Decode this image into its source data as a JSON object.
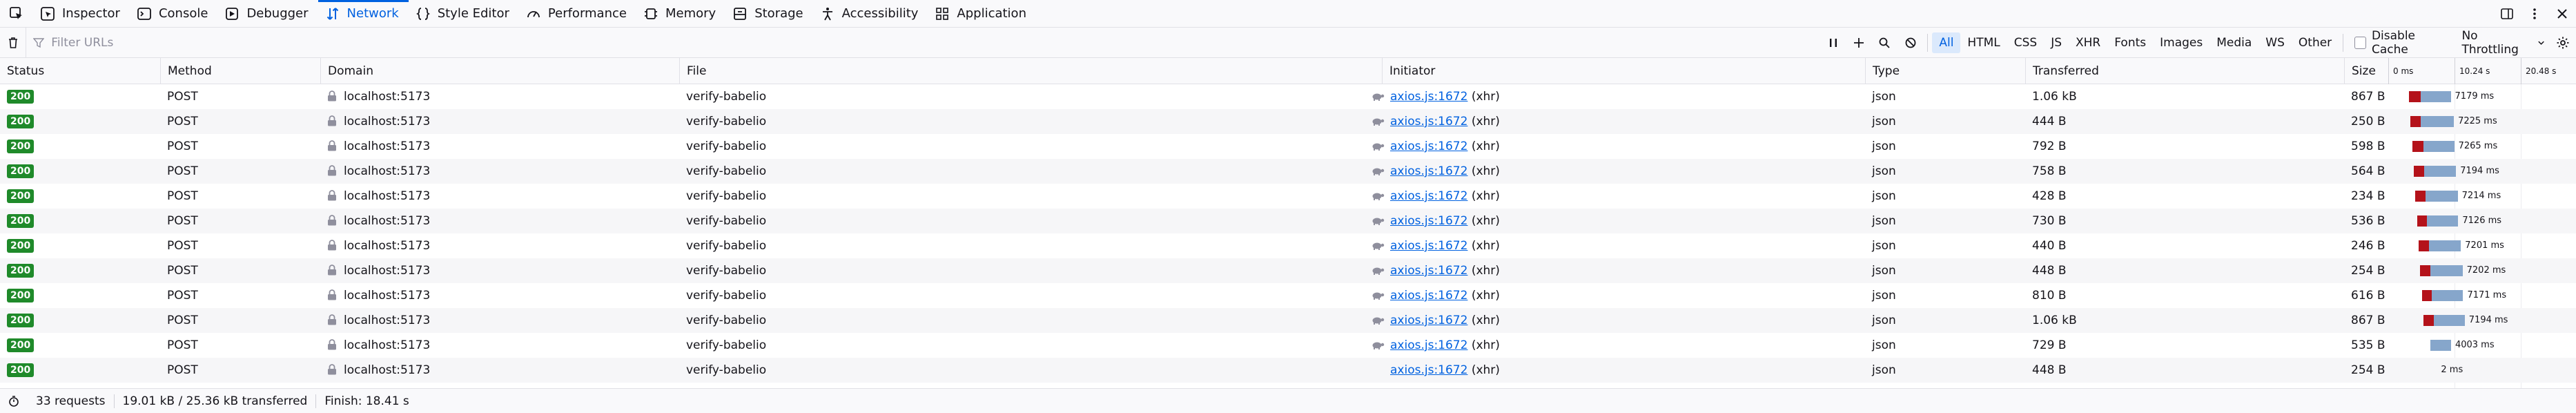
{
  "tabs": [
    {
      "label": "Inspector",
      "icon": "inspector-icon"
    },
    {
      "label": "Console",
      "icon": "console-icon"
    },
    {
      "label": "Debugger",
      "icon": "debugger-icon"
    },
    {
      "label": "Network",
      "icon": "network-icon",
      "selected": true
    },
    {
      "label": "Style Editor",
      "icon": "style-editor-icon"
    },
    {
      "label": "Performance",
      "icon": "performance-icon"
    },
    {
      "label": "Memory",
      "icon": "memory-icon"
    },
    {
      "label": "Storage",
      "icon": "storage-icon"
    },
    {
      "label": "Accessibility",
      "icon": "accessibility-icon"
    },
    {
      "label": "Application",
      "icon": "application-icon"
    }
  ],
  "toolbar": {
    "filter_placeholder": "Filter URLs",
    "types": [
      {
        "label": "All",
        "checked": true
      },
      {
        "label": "HTML"
      },
      {
        "label": "CSS"
      },
      {
        "label": "JS"
      },
      {
        "label": "XHR"
      },
      {
        "label": "Fonts"
      },
      {
        "label": "Images"
      },
      {
        "label": "Media"
      },
      {
        "label": "WS"
      },
      {
        "label": "Other"
      }
    ],
    "disable_cache_label": "Disable Cache",
    "throttling_label": "No Throttling"
  },
  "columns": {
    "status": "Status",
    "method": "Method",
    "domain": "Domain",
    "file": "File",
    "initiator": "Initiator",
    "type": "Type",
    "transferred": "Transferred",
    "size": "Size"
  },
  "waterfall_ticks": [
    "0 ms",
    "10.24 s",
    "20.48 s"
  ],
  "requests": [
    {
      "status": "200",
      "method": "POST",
      "domain": "localhost:5173",
      "file": "verify-babelio",
      "initiator_link": "axios.js:1672",
      "initiator_cause": "(xhr)",
      "throttled": true,
      "type": "json",
      "transferred": "1.06 kB",
      "size": "867 B",
      "start": 0.0,
      "blocked": 0.7,
      "wait": 1.4,
      "timing": "7179 ms"
    },
    {
      "status": "200",
      "method": "POST",
      "domain": "localhost:5173",
      "file": "verify-babelio",
      "initiator_link": "axios.js:1672",
      "initiator_cause": "(xhr)",
      "throttled": true,
      "type": "json",
      "transferred": "444 B",
      "size": "250 B",
      "start": 0.25,
      "blocked": 0.6,
      "wait": 1.55,
      "timing": "7225 ms"
    },
    {
      "status": "200",
      "method": "POST",
      "domain": "localhost:5173",
      "file": "verify-babelio",
      "initiator_link": "axios.js:1672",
      "initiator_cause": "(xhr)",
      "throttled": true,
      "type": "json",
      "transferred": "792 B",
      "size": "598 B",
      "start": 0.5,
      "blocked": 0.65,
      "wait": 1.45,
      "timing": "7265 ms"
    },
    {
      "status": "200",
      "method": "POST",
      "domain": "localhost:5173",
      "file": "verify-babelio",
      "initiator_link": "axios.js:1672",
      "initiator_cause": "(xhr)",
      "throttled": true,
      "type": "json",
      "transferred": "758 B",
      "size": "564 B",
      "start": 0.75,
      "blocked": 0.6,
      "wait": 1.5,
      "timing": "7194 ms"
    },
    {
      "status": "200",
      "method": "POST",
      "domain": "localhost:5173",
      "file": "verify-babelio",
      "initiator_link": "axios.js:1672",
      "initiator_cause": "(xhr)",
      "throttled": true,
      "type": "json",
      "transferred": "428 B",
      "size": "234 B",
      "start": 1.0,
      "blocked": 0.6,
      "wait": 1.5,
      "timing": "7214 ms"
    },
    {
      "status": "200",
      "method": "POST",
      "domain": "localhost:5173",
      "file": "verify-babelio",
      "initiator_link": "axios.js:1672",
      "initiator_cause": "(xhr)",
      "throttled": true,
      "type": "json",
      "transferred": "730 B",
      "size": "536 B",
      "start": 1.25,
      "blocked": 0.6,
      "wait": 1.45,
      "timing": "7126 ms"
    },
    {
      "status": "200",
      "method": "POST",
      "domain": "localhost:5173",
      "file": "verify-babelio",
      "initiator_link": "axios.js:1672",
      "initiator_cause": "(xhr)",
      "throttled": true,
      "type": "json",
      "transferred": "440 B",
      "size": "246 B",
      "start": 1.5,
      "blocked": 0.6,
      "wait": 1.5,
      "timing": "7201 ms"
    },
    {
      "status": "200",
      "method": "POST",
      "domain": "localhost:5173",
      "file": "verify-babelio",
      "initiator_link": "axios.js:1672",
      "initiator_cause": "(xhr)",
      "throttled": true,
      "type": "json",
      "transferred": "448 B",
      "size": "254 B",
      "start": 1.75,
      "blocked": 0.6,
      "wait": 1.5,
      "timing": "7202 ms"
    },
    {
      "status": "200",
      "method": "POST",
      "domain": "localhost:5173",
      "file": "verify-babelio",
      "initiator_link": "axios.js:1672",
      "initiator_cause": "(xhr)",
      "throttled": true,
      "type": "json",
      "transferred": "810 B",
      "size": "616 B",
      "start": 2.0,
      "blocked": 0.6,
      "wait": 1.45,
      "timing": "7171 ms"
    },
    {
      "status": "200",
      "method": "POST",
      "domain": "localhost:5173",
      "file": "verify-babelio",
      "initiator_link": "axios.js:1672",
      "initiator_cause": "(xhr)",
      "throttled": true,
      "type": "json",
      "transferred": "1.06 kB",
      "size": "867 B",
      "start": 2.25,
      "blocked": 0.6,
      "wait": 1.45,
      "timing": "7194 ms"
    },
    {
      "status": "200",
      "method": "POST",
      "domain": "localhost:5173",
      "file": "verify-babelio",
      "initiator_link": "axios.js:1672",
      "initiator_cause": "(xhr)",
      "throttled": true,
      "type": "json",
      "transferred": "729 B",
      "size": "535 B",
      "start": 3.35,
      "blocked": 0.0,
      "wait": 0.95,
      "timing": "4003 ms"
    },
    {
      "status": "200",
      "method": "POST",
      "domain": "localhost:5173",
      "file": "verify-babelio",
      "initiator_link": "axios.js:1672",
      "initiator_cause": "(xhr)",
      "throttled": false,
      "type": "json",
      "transferred": "448 B",
      "size": "254 B",
      "start": 4.3,
      "blocked": 0.0,
      "wait": 0.0,
      "timing": "2 ms"
    }
  ],
  "summary": {
    "requests": "33 requests",
    "transferred": "19.01 kB / 25.36 kB transferred",
    "finish": "Finish: 18.41 s"
  },
  "colors": {
    "accent": "#0061e0",
    "status_ok": "#1f8a2a",
    "waterfall_blocked": "#b4121a",
    "waterfall_wait": "#86a6cb"
  }
}
